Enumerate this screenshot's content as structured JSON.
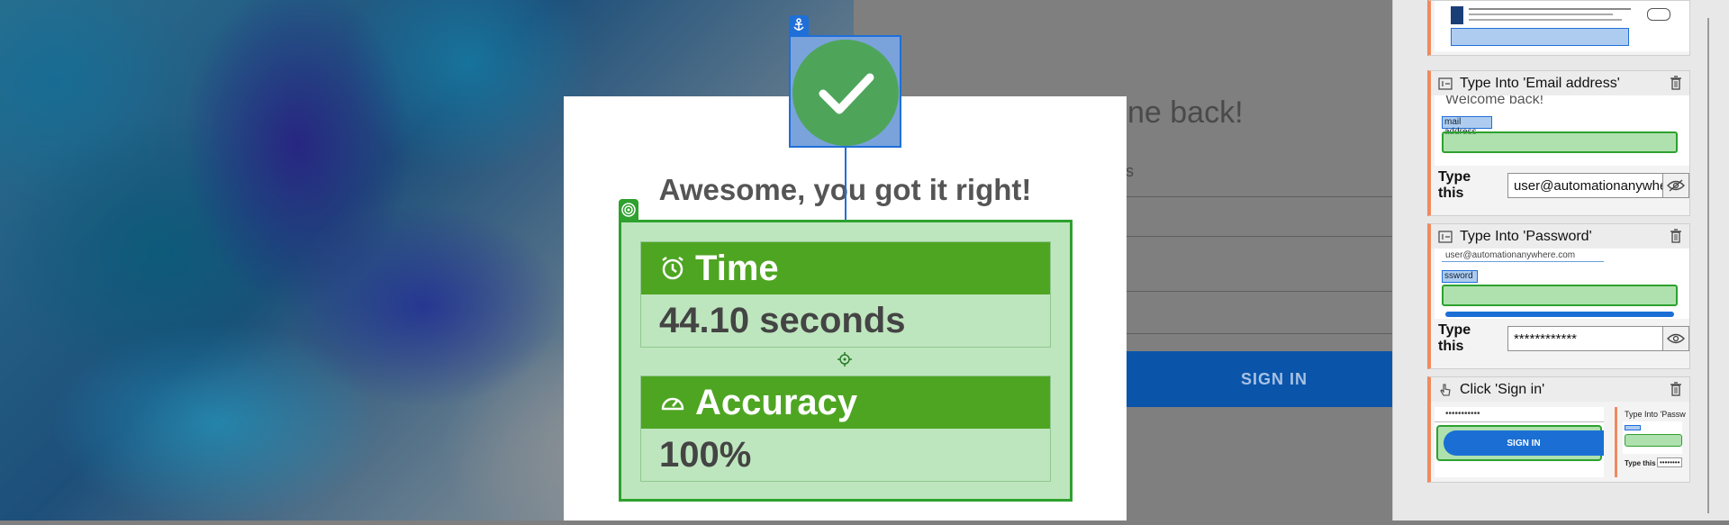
{
  "background_login": {
    "title": "ne back!",
    "field_label": "s",
    "sign_in_label": "SIGN IN"
  },
  "modal": {
    "headline": "Awesome, you got it right!",
    "time_label": "Time",
    "time_value": "44.10 seconds",
    "accuracy_label": "Accuracy",
    "accuracy_value": "100%"
  },
  "steps": [
    {
      "title": "Type Into 'Email address'",
      "preview_heading": "Welcome back!",
      "preview_field": "mail address",
      "type_label": "Type this",
      "value": "user@automationanywhere.com"
    },
    {
      "title": "Type Into 'Password'",
      "preview_value": "user@automationanywhere.com",
      "preview_field": "ssword",
      "type_label": "Type this",
      "value": "************"
    },
    {
      "title": "Click 'Sign in'",
      "preview_value": "•••••••••••",
      "preview_button": "SIGN IN",
      "mini_title": "Type Into 'Passw",
      "mini_type": "Type this",
      "mini_value": "••••••••"
    }
  ],
  "colors": {
    "accent_green": "#4ea522",
    "anchor_blue": "#1f6fd8",
    "sign_in_blue": "#0a55aa",
    "step_accent": "#f08a5d"
  },
  "icons": {
    "anchor": "anchor-icon",
    "check": "check-icon",
    "target": "target-icon",
    "clock": "alarm-clock-icon",
    "gauge": "speedometer-icon",
    "trash": "trash-icon",
    "eye": "eye-icon",
    "eye_off": "eye-off-icon"
  }
}
